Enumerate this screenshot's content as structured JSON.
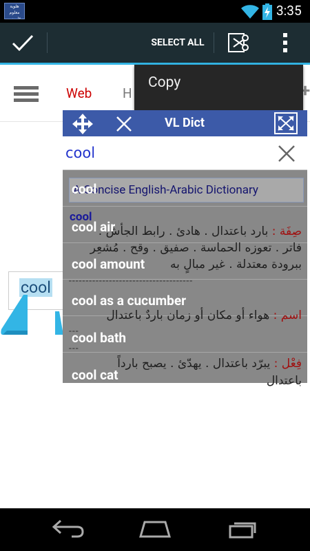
{
  "status_bar": {
    "time": "3:35",
    "app_icon_text": "هلوية معلوم قاموس"
  },
  "action_bar": {
    "select_all_label": "SELECT ALL"
  },
  "copy_menu": {
    "copy_label": "Copy"
  },
  "browser": {
    "tab_web": "Web",
    "tab_partial": "H"
  },
  "page": {
    "selected_word": "cool"
  },
  "dict": {
    "title": "VL Dict",
    "search_value": "cool",
    "results": [
      "cool",
      "cool air",
      "cool amount",
      "cool as a cucumber",
      "cool bath",
      "cool cat"
    ],
    "definition": {
      "dictionary_name": "A Concise English-Arabic Dictionary",
      "headword": "cool",
      "adj_pos": "صِفَة :",
      "adj_text_1": "بارد باعتدال . هادئ . رابط الجأش .",
      "adj_text_2": "فاتر . تعوزه الحماسة . صفيق . وقح . مُشعِر",
      "adj_text_3": "ببرودة معتدلة . غير مبالٍ به",
      "dashes": "-------------------------------------",
      "noun_pos": "اسم :",
      "noun_text": "هواء أو مكان أو زمان باردٌ باعتدال",
      "short_dash": "---",
      "verb_pos": "فِعْل :",
      "verb_text_1": "يبرّد باعتدال . يهدّئ . يصبح بارداً",
      "verb_text_2": "باعتدال"
    }
  },
  "colors": {
    "action_bar": "#1d2d33",
    "accent": "#33b5e5",
    "dict_title_bar": "#3c5aa8",
    "dict_body": "#888888",
    "tab_web": "#cc0000",
    "selection": "#b6dff2"
  }
}
